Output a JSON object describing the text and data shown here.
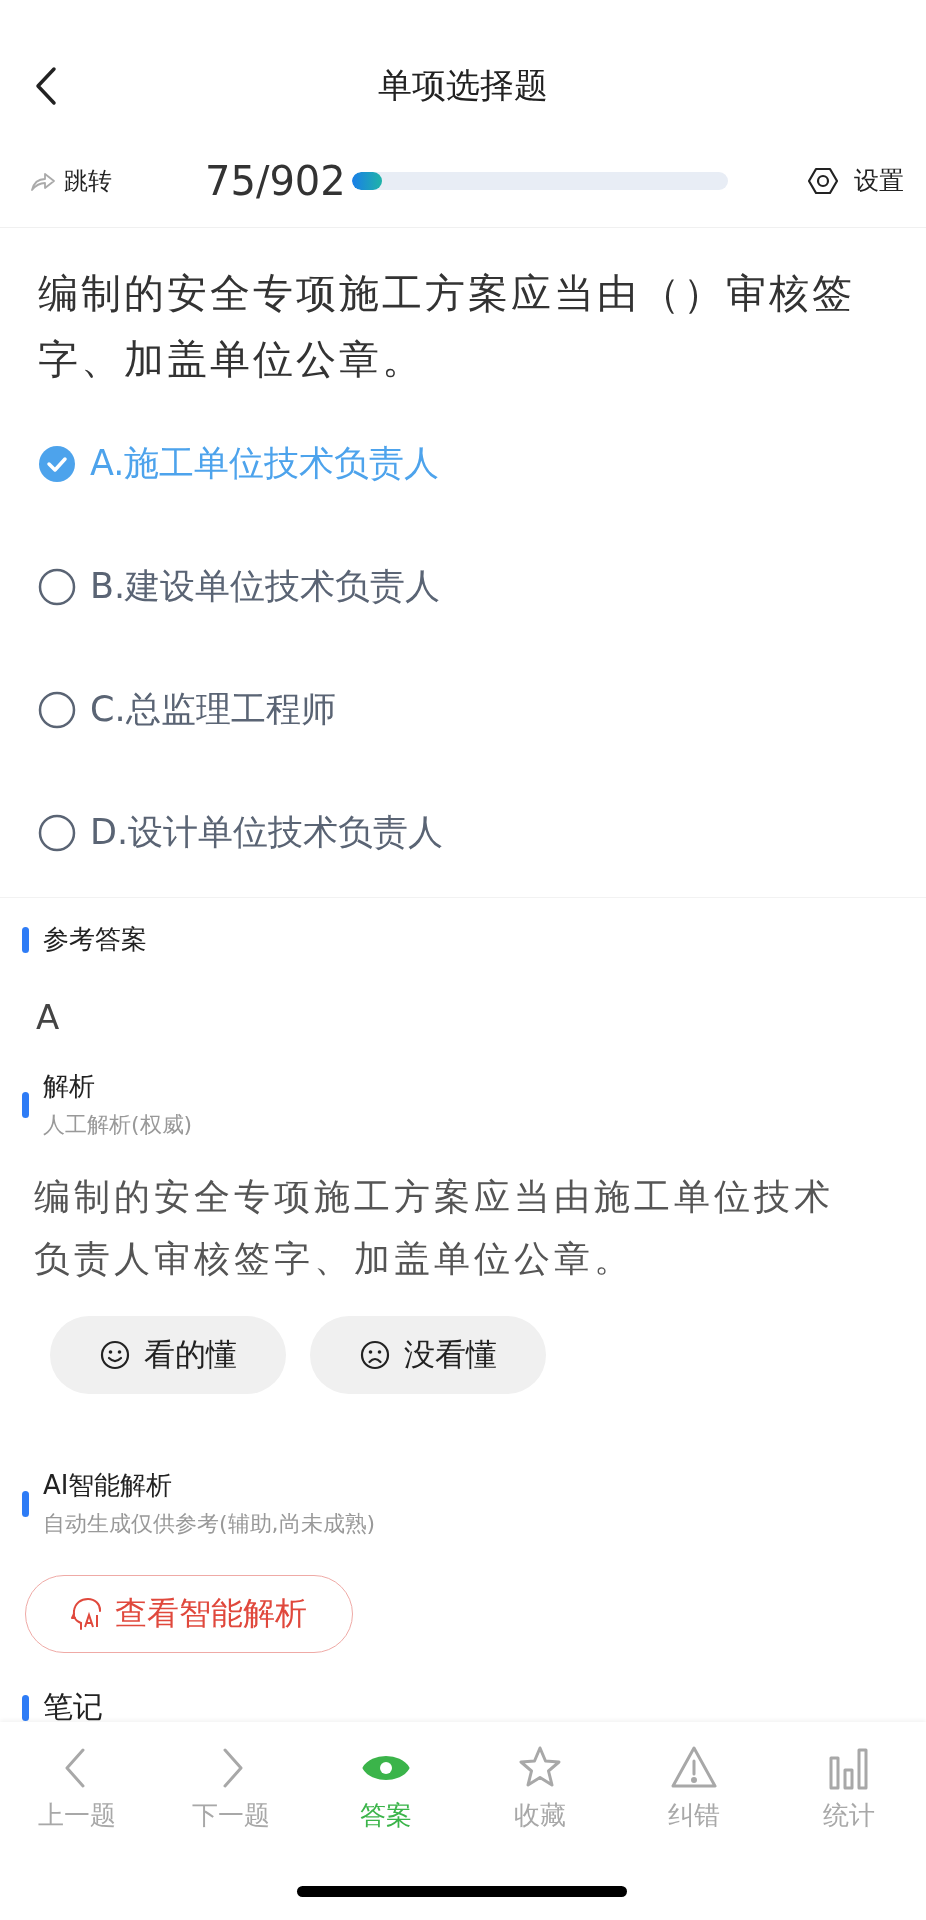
{
  "header": {
    "title": "单项选择题"
  },
  "toolbar": {
    "jump": "跳转",
    "progress_text": "75/902",
    "level": 0.08,
    "settings": "设置"
  },
  "question": {
    "text": "编制的安全专项施工方案应当由（）审核签字、加盖单位公章。",
    "options": [
      {
        "label": "A.施工单位技术负责人",
        "selected": true
      },
      {
        "label": "B.建设单位技术负责人",
        "selected": false
      },
      {
        "label": "C.总监理工程师",
        "selected": false
      },
      {
        "label": "D.设计单位技术负责人",
        "selected": false
      }
    ]
  },
  "reference": {
    "title": "参考答案",
    "answer": "A"
  },
  "analysis": {
    "title": "解析",
    "subtitle": "人工解析(权威)",
    "text": "编制的安全专项施工方案应当由施工单位技术负责人审核签字、加盖单位公章。",
    "feedback": [
      {
        "kind": "smile",
        "label": "看的懂"
      },
      {
        "kind": "frown",
        "label": "没看懂"
      }
    ]
  },
  "ai_analysis": {
    "title": "AI智能解析",
    "subtitle": "自动生成仅供参考(辅助,尚未成熟)",
    "button": "查看智能解析"
  },
  "notes": {
    "title": "笔记"
  },
  "bottom_nav": [
    {
      "kind": "prev",
      "label": "上一题",
      "selected": false
    },
    {
      "kind": "next",
      "label": "下一题",
      "selected": false
    },
    {
      "kind": "answer",
      "label": "答案",
      "selected": true
    },
    {
      "kind": "favorite",
      "label": "收藏",
      "selected": false
    },
    {
      "kind": "report",
      "label": "纠错",
      "selected": false
    },
    {
      "kind": "stats",
      "label": "统计",
      "selected": false
    }
  ]
}
